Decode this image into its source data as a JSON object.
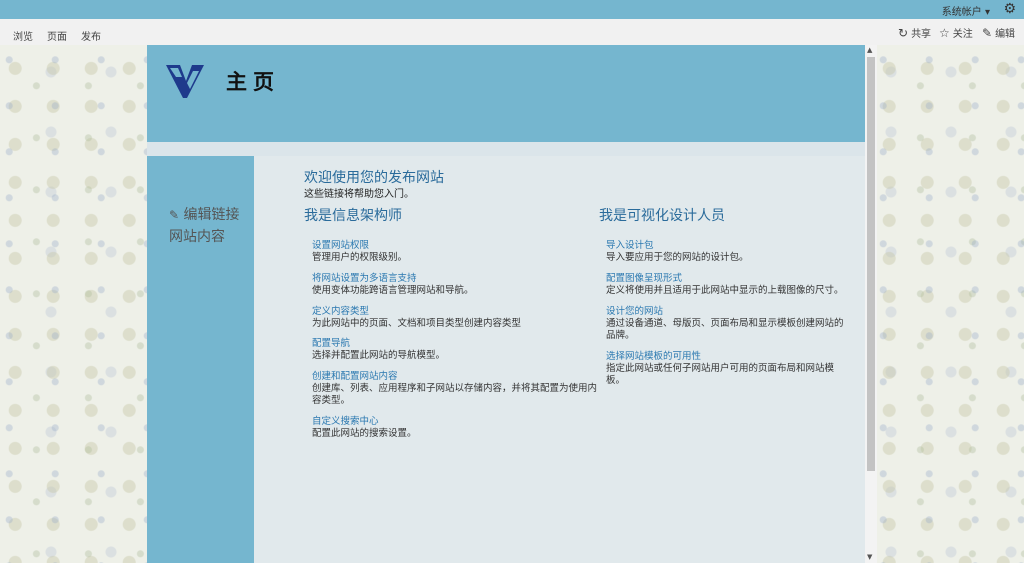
{
  "suitebar": {
    "account": "系统帐户 ▾"
  },
  "ribbon": {
    "tabs": [
      "浏览",
      "页面",
      "发布"
    ],
    "actions": {
      "share": "共享",
      "follow": "关注",
      "edit": "编辑"
    }
  },
  "site": {
    "title": "主页"
  },
  "leftnav": {
    "edit_links": "编辑链接",
    "site_contents": "网站内容"
  },
  "main": {
    "welcome": "欢迎使用您的发布网站",
    "subtitle": "这些链接将帮助您入门。",
    "col1": {
      "heading": "我是信息架构师",
      "items": [
        {
          "title": "设置网站权限",
          "desc": "管理用户的权限级别。"
        },
        {
          "title": "将网站设置为多语言支持",
          "desc": "使用变体功能跨语言管理网站和导航。"
        },
        {
          "title": "定义内容类型",
          "desc": "为此网站中的页面、文档和项目类型创建内容类型"
        },
        {
          "title": "配置导航",
          "desc": "选择并配置此网站的导航模型。"
        },
        {
          "title": "创建和配置网站内容",
          "desc": "创建库、列表、应用程序和子网站以存储内容，并将其配置为使用内容类型。"
        },
        {
          "title": "自定义搜索中心",
          "desc": "配置此网站的搜索设置。"
        }
      ]
    },
    "col2": {
      "heading": "我是可视化设计人员",
      "items": [
        {
          "title": "导入设计包",
          "desc": "导入要应用于您的网站的设计包。"
        },
        {
          "title": "配置图像呈现形式",
          "desc": "定义将使用并且适用于此网站中显示的上载图像的尺寸。"
        },
        {
          "title": "设计您的网站",
          "desc": "通过设备通道、母版页、页面布局和显示模板创建网站的品牌。"
        },
        {
          "title": "选择网站模板的可用性",
          "desc": "指定此网站或任何子网站用户可用的页面布局和网站模板。"
        }
      ]
    }
  },
  "colors": {
    "accent": "#75b6cf",
    "link": "#2a78b0",
    "heading": "#2a6b9b",
    "logo": "#1e3a8c"
  }
}
